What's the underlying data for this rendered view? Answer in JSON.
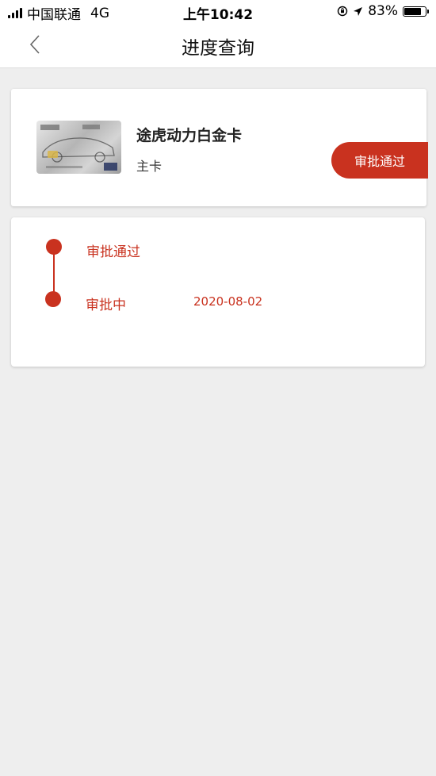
{
  "status_bar": {
    "carrier": "中国联通",
    "network": "4G",
    "time": "上午10:42",
    "battery_percent": "83%",
    "battery_level": 0.83
  },
  "nav": {
    "title": "进度查询",
    "back_icon": "chevron-left-icon"
  },
  "card": {
    "name": "途虎动力白金卡",
    "type": "主卡",
    "status": "审批通过"
  },
  "timeline": [
    {
      "label": "审批通过",
      "date": ""
    },
    {
      "label": "审批中",
      "date": "2020-08-02"
    }
  ],
  "colors": {
    "accent": "#c9321f",
    "background": "#eeeeee"
  }
}
